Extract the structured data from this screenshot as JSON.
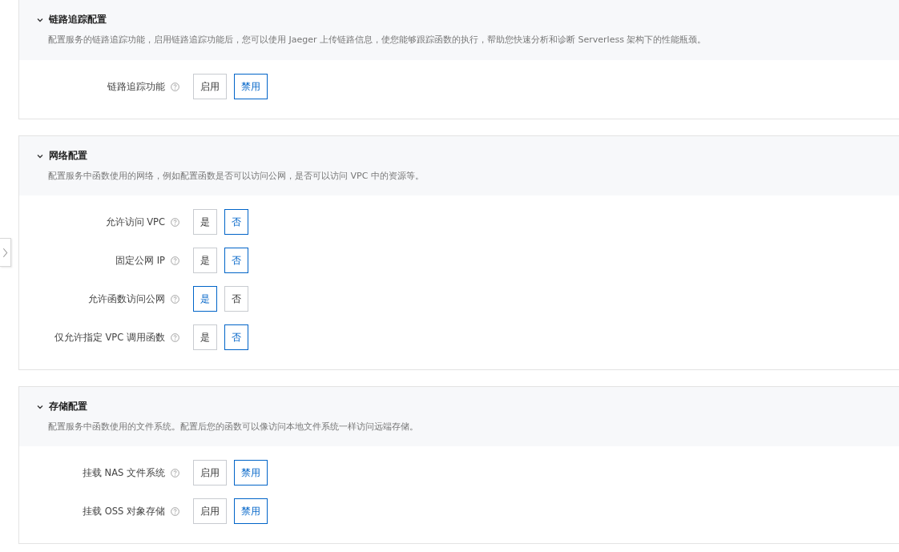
{
  "sections": [
    {
      "title": "链路追踪配置",
      "expanded": true,
      "description": "配置服务的链路追踪功能，启用链路追踪功能后，您可以使用 Jaeger 上传链路信息，使您能够跟踪函数的执行，帮助您快速分析和诊断 Serverless 架构下的性能瓶颈。",
      "fields": [
        {
          "label": "链路追踪功能",
          "options": [
            {
              "label": "启用",
              "selected": false
            },
            {
              "label": "禁用",
              "selected": true
            }
          ]
        }
      ]
    },
    {
      "title": "网络配置",
      "expanded": true,
      "description": "配置服务中函数使用的网络，例如配置函数是否可以访问公网，是否可以访问 VPC 中的资源等。",
      "fields": [
        {
          "label": "允许访问 VPC",
          "options": [
            {
              "label": "是",
              "selected": false
            },
            {
              "label": "否",
              "selected": true
            }
          ]
        },
        {
          "label": "固定公网 IP",
          "options": [
            {
              "label": "是",
              "selected": false
            },
            {
              "label": "否",
              "selected": true
            }
          ]
        },
        {
          "label": "允许函数访问公网",
          "options": [
            {
              "label": "是",
              "selected": true
            },
            {
              "label": "否",
              "selected": false
            }
          ]
        },
        {
          "label": "仅允许指定 VPC 调用函数",
          "options": [
            {
              "label": "是",
              "selected": false
            },
            {
              "label": "否",
              "selected": true
            }
          ]
        }
      ]
    },
    {
      "title": "存储配置",
      "expanded": true,
      "description": "配置服务中函数使用的文件系统。配置后您的函数可以像访问本地文件系统一样访问远端存储。",
      "fields": [
        {
          "label": "挂载 NAS 文件系统",
          "options": [
            {
              "label": "启用",
              "selected": false
            },
            {
              "label": "禁用",
              "selected": true
            }
          ]
        },
        {
          "label": "挂载 OSS 对象存储",
          "options": [
            {
              "label": "启用",
              "selected": false
            },
            {
              "label": "禁用",
              "selected": true
            }
          ]
        }
      ]
    }
  ]
}
